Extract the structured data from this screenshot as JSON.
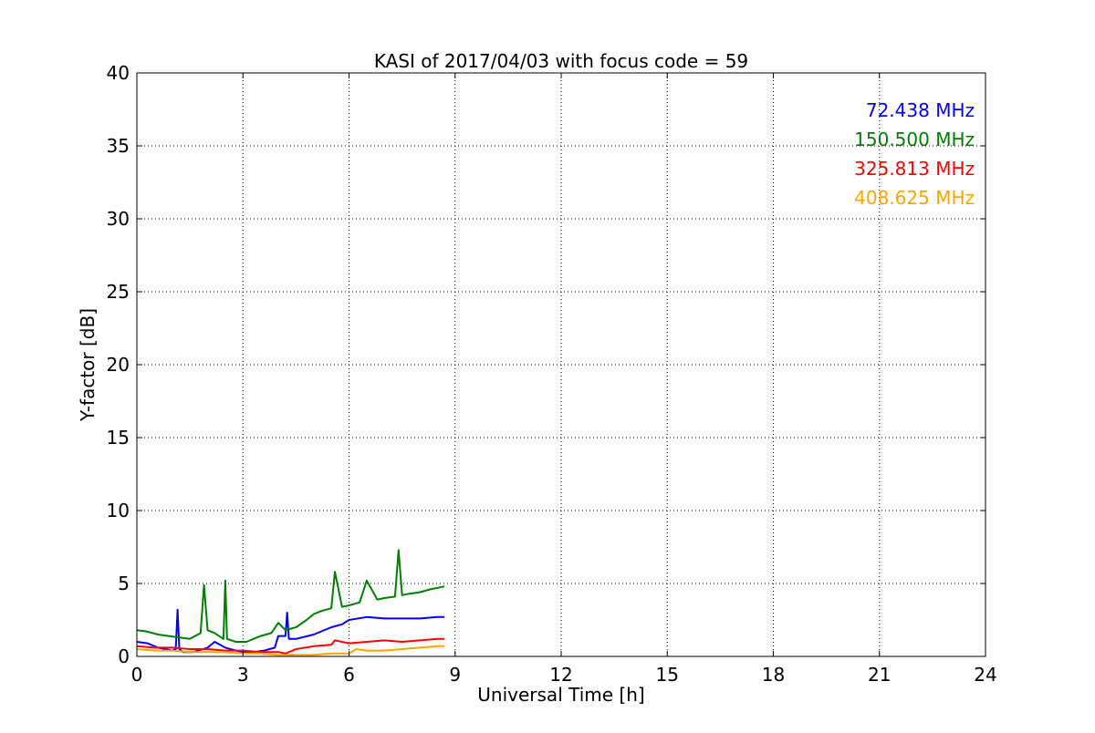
{
  "chart_data": {
    "type": "line",
    "title": "KASI of 2017/04/03 with focus code = 59",
    "xlabel": "Universal Time [h]",
    "ylabel": "Y-factor [dB]",
    "xlim": [
      0,
      24
    ],
    "ylim": [
      0,
      40
    ],
    "xticks": [
      0,
      3,
      6,
      9,
      12,
      15,
      18,
      21,
      24
    ],
    "yticks": [
      0,
      5,
      10,
      15,
      20,
      25,
      30,
      35,
      40
    ],
    "grid": true,
    "legend_position": "top-right",
    "series": [
      {
        "name": "72.438 MHz",
        "color": "#0000ff",
        "x": [
          0.0,
          0.3,
          0.6,
          1.0,
          1.1,
          1.15,
          1.2,
          1.3,
          1.6,
          2.0,
          2.2,
          2.5,
          2.8,
          3.0,
          3.3,
          3.6,
          3.9,
          4.0,
          4.1,
          4.2,
          4.25,
          4.3,
          4.5,
          5.0,
          5.5,
          5.8,
          6.0,
          6.5,
          7.0,
          7.5,
          8.0,
          8.5,
          8.7
        ],
        "y": [
          1.0,
          0.9,
          0.6,
          0.4,
          0.5,
          3.2,
          0.5,
          0.3,
          0.3,
          0.6,
          1.0,
          0.6,
          0.4,
          0.3,
          0.3,
          0.4,
          0.6,
          1.4,
          1.4,
          1.4,
          3.0,
          1.2,
          1.2,
          1.5,
          2.0,
          2.2,
          2.5,
          2.7,
          2.6,
          2.6,
          2.6,
          2.7,
          2.7
        ]
      },
      {
        "name": "150.500 MHz",
        "color": "#008000",
        "x": [
          0.0,
          0.3,
          0.6,
          0.9,
          1.2,
          1.5,
          1.8,
          1.9,
          2.0,
          2.2,
          2.45,
          2.5,
          2.55,
          2.8,
          3.1,
          3.5,
          3.8,
          4.0,
          4.2,
          4.5,
          4.8,
          5.0,
          5.2,
          5.5,
          5.6,
          5.8,
          6.0,
          6.3,
          6.5,
          6.8,
          7.0,
          7.3,
          7.4,
          7.5,
          7.7,
          8.0,
          8.3,
          8.5,
          8.7
        ],
        "y": [
          1.8,
          1.7,
          1.5,
          1.4,
          1.3,
          1.2,
          1.6,
          4.9,
          1.8,
          1.6,
          1.2,
          5.2,
          1.2,
          1.0,
          1.0,
          1.4,
          1.6,
          2.3,
          1.8,
          2.0,
          2.5,
          2.9,
          3.1,
          3.3,
          5.8,
          3.4,
          3.5,
          3.7,
          5.2,
          3.9,
          4.0,
          4.1,
          7.3,
          4.2,
          4.3,
          4.4,
          4.6,
          4.7,
          4.8
        ]
      },
      {
        "name": "325.813 MHz",
        "color": "#ff0000",
        "x": [
          0.0,
          0.5,
          1.0,
          1.5,
          2.0,
          2.5,
          3.0,
          3.5,
          4.0,
          4.2,
          4.5,
          5.0,
          5.5,
          5.6,
          6.0,
          6.5,
          7.0,
          7.5,
          8.0,
          8.5,
          8.7
        ],
        "y": [
          0.7,
          0.6,
          0.6,
          0.5,
          0.5,
          0.4,
          0.4,
          0.3,
          0.3,
          0.2,
          0.5,
          0.7,
          0.8,
          1.1,
          0.9,
          1.0,
          1.1,
          1.0,
          1.1,
          1.2,
          1.2
        ]
      },
      {
        "name": "408.625 MHz",
        "color": "#ffa500",
        "x": [
          0.0,
          0.5,
          1.0,
          1.5,
          2.0,
          2.5,
          3.0,
          3.5,
          4.0,
          4.5,
          5.0,
          5.5,
          6.0,
          6.2,
          6.5,
          7.0,
          7.5,
          8.0,
          8.5,
          8.7
        ],
        "y": [
          0.5,
          0.4,
          0.4,
          0.3,
          0.3,
          0.3,
          0.2,
          0.2,
          0.1,
          0.1,
          0.1,
          0.2,
          0.2,
          0.5,
          0.4,
          0.4,
          0.5,
          0.6,
          0.7,
          0.7
        ]
      }
    ]
  }
}
